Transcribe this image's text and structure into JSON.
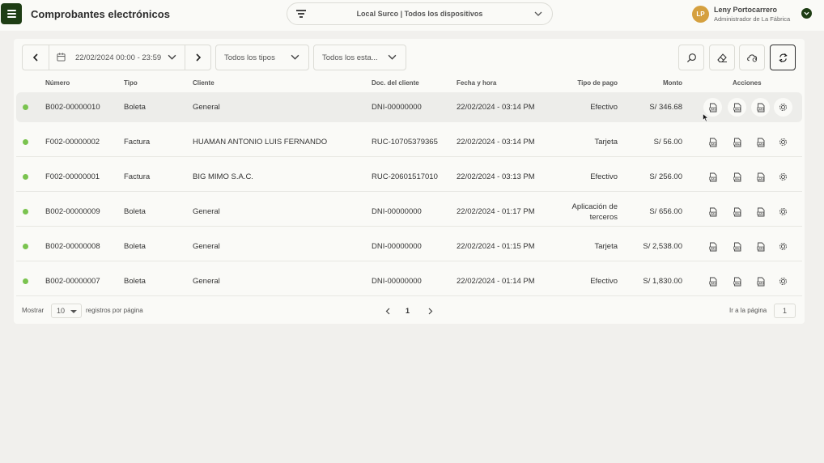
{
  "app": {
    "title": "Comprobantes electrónicos",
    "location": "Local Surco | Todos los dispositivos"
  },
  "user": {
    "initials": "LP",
    "name": "Leny Portocarrero",
    "role": "Administrador de La Fábrica"
  },
  "filters": {
    "date_range": "22/02/2024 00:00 - 23:59",
    "type": "Todos los tipos",
    "state": "Todos los esta..."
  },
  "table": {
    "headers": {
      "numero": "Número",
      "tipo": "Tipo",
      "cliente": "Cliente",
      "doc": "Doc. del cliente",
      "fecha": "Fecha y hora",
      "pago": "Tipo de pago",
      "monto": "Monto",
      "acciones": "Acciones"
    },
    "rows": [
      {
        "numero": "B002-00000010",
        "tipo": "Boleta",
        "cliente": "General",
        "doc": "DNI-00000000",
        "fecha": "22/02/2024 - 03:14 PM",
        "pago": [
          "Efectivo"
        ],
        "monto": "S/ 346.68"
      },
      {
        "numero": "F002-00000002",
        "tipo": "Factura",
        "cliente": "HUAMAN ANTONIO LUIS FERNANDO",
        "doc": "RUC-10705379365",
        "fecha": "22/02/2024 - 03:14 PM",
        "pago": [
          "Tarjeta"
        ],
        "monto": "S/ 56.00"
      },
      {
        "numero": "F002-00000001",
        "tipo": "Factura",
        "cliente": "BIG MIMO S.A.C.",
        "doc": "RUC-20601517010",
        "fecha": "22/02/2024 - 03:13 PM",
        "pago": [
          "Efectivo"
        ],
        "monto": "S/ 256.00"
      },
      {
        "numero": "B002-00000009",
        "tipo": "Boleta",
        "cliente": "General",
        "doc": "DNI-00000000",
        "fecha": "22/02/2024 - 01:17 PM",
        "pago": [
          "Aplicación de",
          "terceros"
        ],
        "monto": "S/ 656.00"
      },
      {
        "numero": "B002-00000008",
        "tipo": "Boleta",
        "cliente": "General",
        "doc": "DNI-00000000",
        "fecha": "22/02/2024 - 01:15 PM",
        "pago": [
          "Tarjeta"
        ],
        "monto": "S/ 2,538.00"
      },
      {
        "numero": "B002-00000007",
        "tipo": "Boleta",
        "cliente": "General",
        "doc": "DNI-00000000",
        "fecha": "22/02/2024 - 01:14 PM",
        "pago": [
          "Efectivo"
        ],
        "monto": "S/ 1,830.00"
      }
    ],
    "status_color": "#7ac34f",
    "action_icons": [
      "pdf-icon",
      "xml-icon",
      "cdr-icon",
      "settings-icon"
    ]
  },
  "footer": {
    "show_label": "Mostrar",
    "per_page": "10",
    "per_page_label": "registros por página",
    "current_page": "1",
    "goto_label": "Ir a la página",
    "goto_value": "1"
  },
  "colors": {
    "brand_dark": "#1e3d14",
    "avatar": "#d5a03f",
    "background": "#f1f0ed"
  }
}
